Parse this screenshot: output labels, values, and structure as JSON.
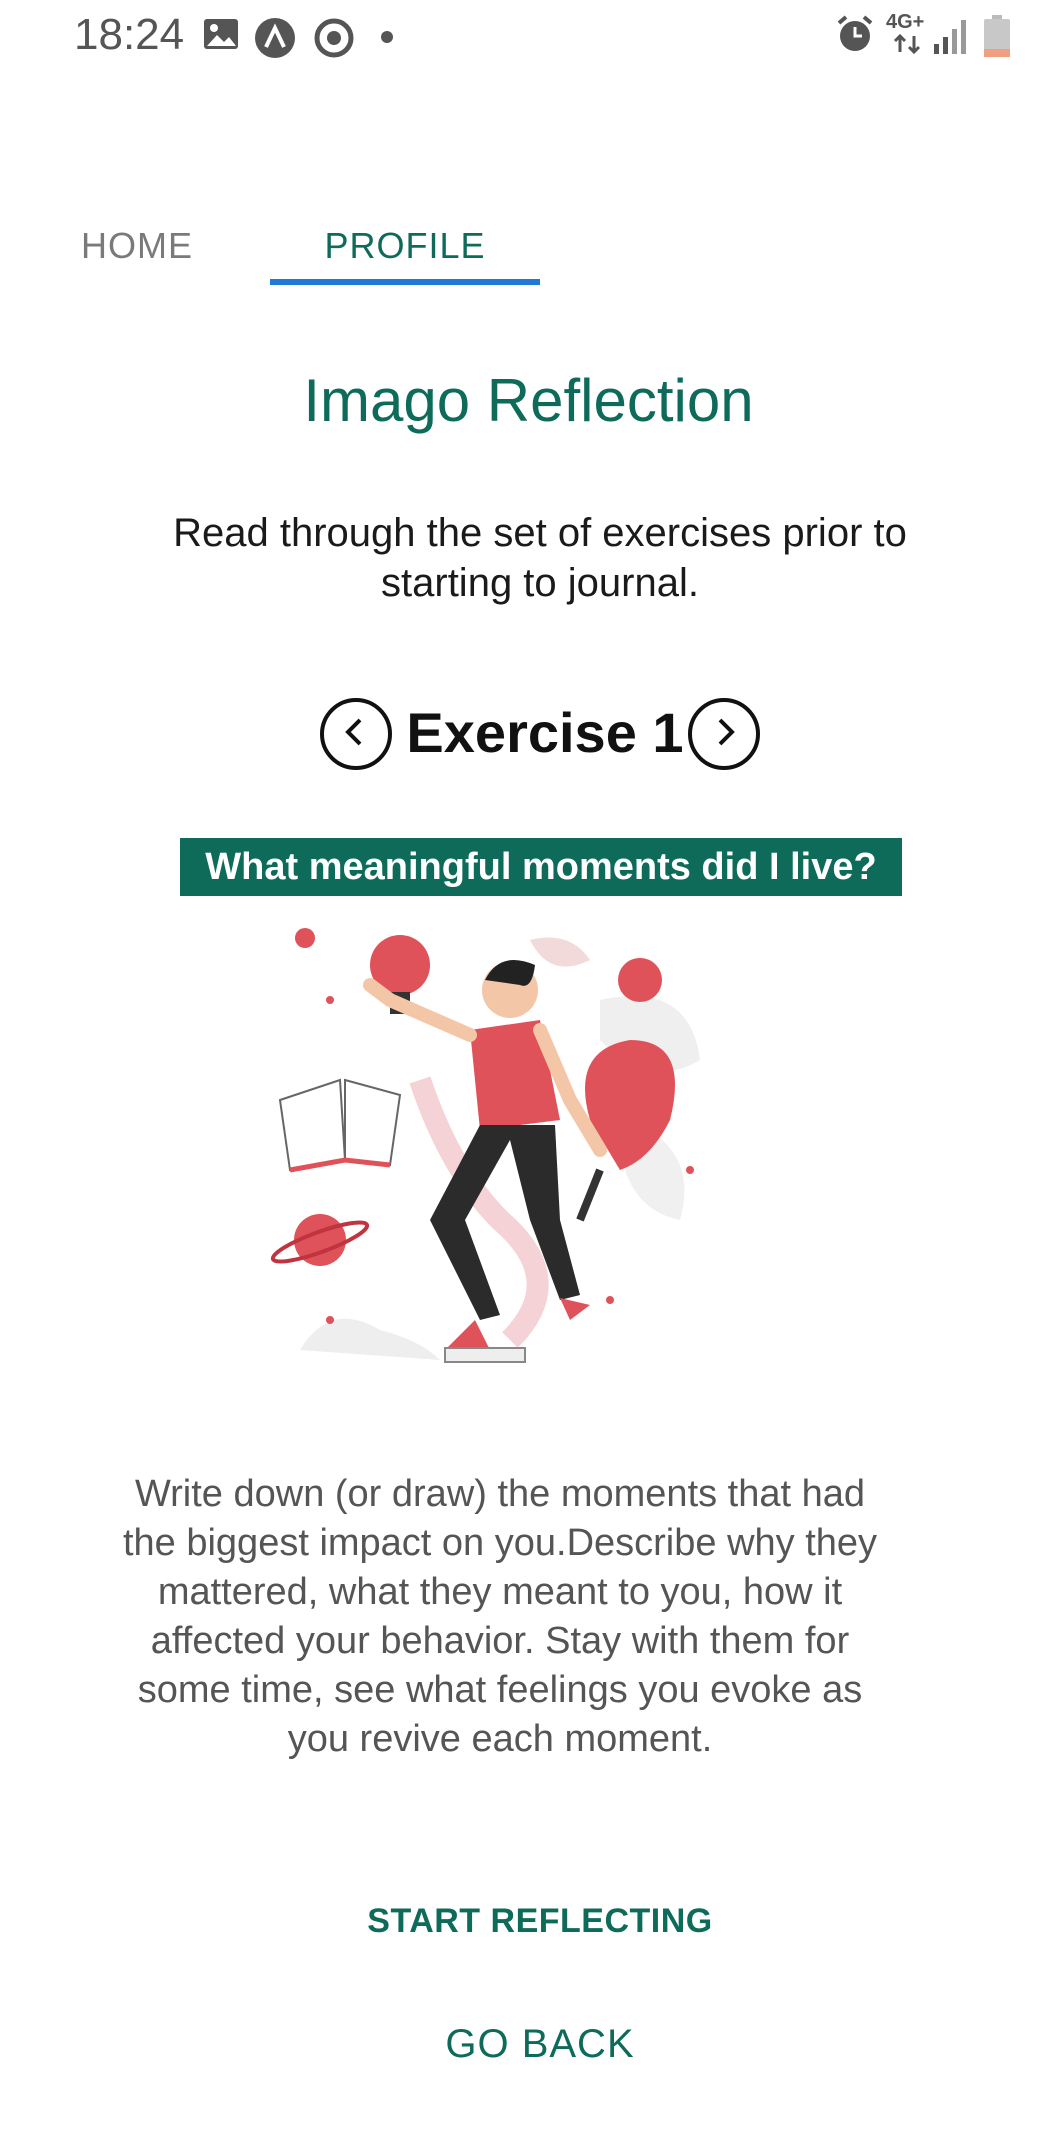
{
  "status_bar": {
    "time": "18:24",
    "network": "4G+"
  },
  "tabs": [
    {
      "label": "HOME",
      "active": false
    },
    {
      "label": "PROFILE",
      "active": true
    }
  ],
  "page": {
    "title": "Imago Reflection",
    "intro": "Read through the set of exercises prior to starting to journal."
  },
  "exercise": {
    "title": "Exercise 1",
    "question": "What meaningful moments did I live?",
    "description": "Write down (or draw) the moments that had the biggest impact on you.Describe why they mattered, what they meant to you, how it affected your behavior. Stay with them for some time, see what feelings you evoke as you revive each moment."
  },
  "actions": {
    "start_label": "START REFLECTING",
    "back_label": "GO BACK"
  },
  "colors": {
    "accent": "#0e6b5a",
    "tab_indicator": "#1e7ad6",
    "illustration_red": "#e0525a"
  },
  "icons": {
    "prev": "chevron-left-circle-icon",
    "next": "chevron-right-circle-icon"
  }
}
